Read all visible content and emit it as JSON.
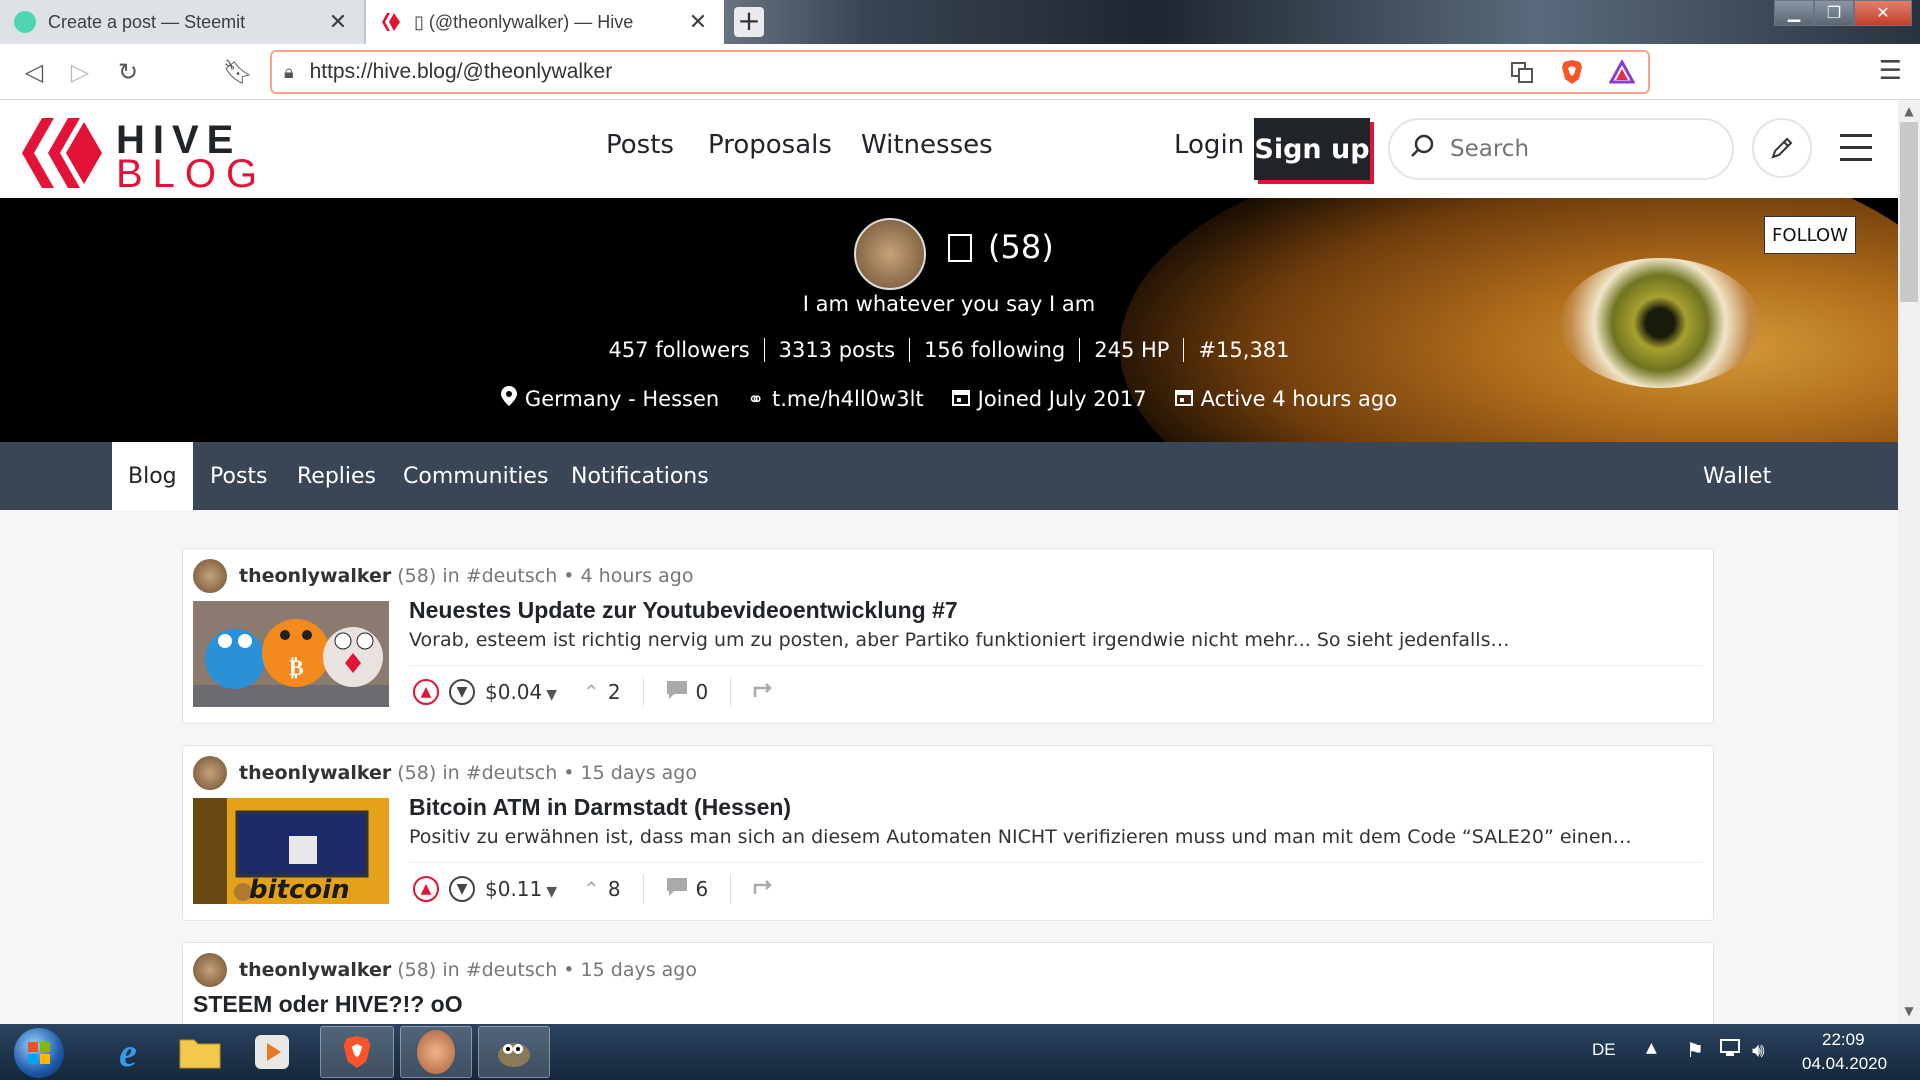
{
  "browser": {
    "tabs": [
      {
        "title": "Create a post — Steemit",
        "favicon_color": "#4ed6b2"
      },
      {
        "title": "▯ (@theonlywalker) — Hive",
        "favicon_color": "#e31337"
      }
    ],
    "close_glyph": "✕",
    "new_tab_glyph": "+",
    "url": "https://hive.blog/@theonlywalker"
  },
  "header": {
    "logo_top": "HIVE",
    "logo_bottom": "BLOG",
    "nav": [
      "Posts",
      "Proposals",
      "Witnesses"
    ],
    "login": "Login",
    "signup": "Sign up",
    "search_placeholder": "Search"
  },
  "profile": {
    "reputation": "(58)",
    "about": "I am whatever you say I am",
    "stats": [
      "457 followers",
      "3313 posts",
      "156 following",
      "245 HP",
      "#15,381"
    ],
    "location": "Germany - Hessen",
    "website": "t.me/h4ll0w3lt",
    "joined": "Joined July 2017",
    "active": "Active 4 hours ago",
    "follow_button": "FOLLOW"
  },
  "profile_tabs": {
    "left": [
      "Blog",
      "Posts",
      "Replies",
      "Communities",
      "Notifications"
    ],
    "active": "Blog",
    "right": "Wallet"
  },
  "posts": [
    {
      "author": "theonlywalker",
      "rep": "(58)",
      "in": "in",
      "community": "#deutsch",
      "time": "• 4 hours ago",
      "title": "Neuestes Update zur Youtubevideoentwicklung #7",
      "excerpt": "Vorab, esteem ist richtig nervig um zu posten, aber Partiko funktioniert irgendwie nicht mehr... So sieht jedenfalls…",
      "payout": "$0.04",
      "votes": "2",
      "comments": "0"
    },
    {
      "author": "theonlywalker",
      "rep": "(58)",
      "in": "in",
      "community": "#deutsch",
      "time": "• 15 days ago",
      "title": "Bitcoin ATM in Darmstadt (Hessen)",
      "excerpt": "Positiv zu erwähnen ist, dass man sich an diesem Automaten NICHT verifizieren muss und man mit dem Code “SALE20” einen…",
      "payout": "$0.11",
      "votes": "8",
      "comments": "6"
    },
    {
      "author": "theonlywalker",
      "rep": "(58)",
      "in": "in",
      "community": "#deutsch",
      "time": "• 15 days ago",
      "title": "STEEM oder HIVE?!? oO"
    }
  ],
  "thumb2_text": "bitcoin",
  "taskbar": {
    "lang": "DE",
    "time": "22:09",
    "date": "04.04.2020"
  },
  "colors": {
    "hive_red": "#e31337",
    "tabs_bar": "#3a4555",
    "dark": "#212529"
  }
}
